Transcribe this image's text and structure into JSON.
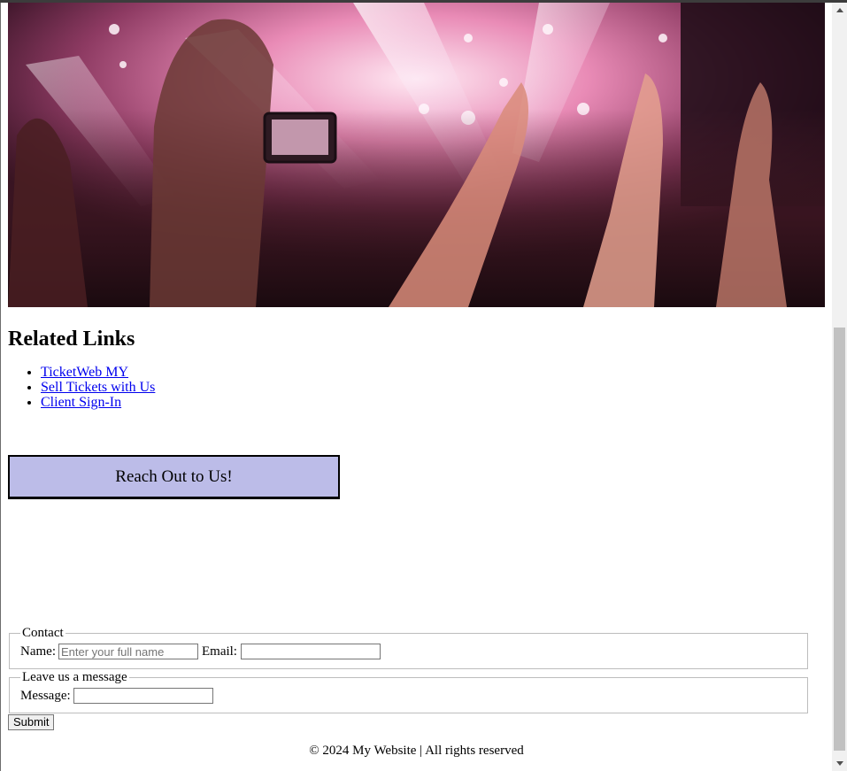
{
  "hero": {
    "image_alt": "concert crowd with raised hands and stage lights"
  },
  "related": {
    "title": "Related Links",
    "links": [
      "TicketWeb MY",
      "Sell Tickets with Us",
      "Client Sign-In"
    ]
  },
  "reach_button": {
    "label": "Reach Out to Us!"
  },
  "contact_form": {
    "contact_legend": "Contact",
    "name_label": "Name:",
    "name_placeholder": "Enter your full name",
    "name_value": "",
    "email_label": "Email:",
    "email_value": "",
    "message_legend": "Leave us a message",
    "message_label": "Message:",
    "message_value": "",
    "submit_label": "Submit"
  },
  "footer": {
    "text": "© 2024 My Website | All rights reserved"
  },
  "colors": {
    "button_bg": "#bcbce8",
    "link": "#0000ee"
  }
}
